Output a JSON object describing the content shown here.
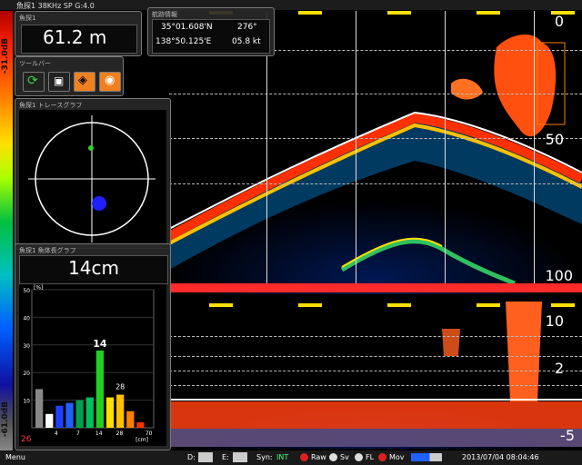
{
  "header": {
    "label": "魚探1 38KHz SP G:4.0"
  },
  "scale": {
    "top_label": "-31.0dB",
    "bottom_label": "-61.0dB"
  },
  "depth_box": {
    "title": "魚探1",
    "value": "61.2 m"
  },
  "position_box": {
    "title": "航跡情報",
    "lat": "35°01.608'N",
    "heading": "276°",
    "lon": "138°50.125'E",
    "speed": "05.8 kt"
  },
  "toolbar": {
    "title": "ツールバー",
    "buttons": [
      "refresh-icon",
      "camera-icon",
      "fish-icon",
      "record-icon"
    ]
  },
  "trace_panel": {
    "title": "魚探1 トレースグラフ"
  },
  "hist_panel": {
    "title": "魚探1 魚体長グラフ",
    "size": "14cm",
    "peak_label": "14",
    "secondary_label": "28",
    "left_bottom": "26"
  },
  "upper_echo": {
    "depth_labels": [
      "0",
      "50",
      "100"
    ]
  },
  "lower_echo": {
    "depth_labels": [
      "10",
      "2",
      "-5"
    ]
  },
  "status": {
    "menu": "Menu",
    "d_label": "D:",
    "e_label": "E:",
    "syn_label": "Syn:",
    "syn_value": "INT",
    "raw": "Raw",
    "sv": "Sv",
    "fl": "FL",
    "mov": "Mov",
    "datetime": "2013/07/04  08:04:46"
  },
  "colors": {
    "accent_yellow": "#ffe000",
    "bar_red": "#ff2a2a",
    "raw_red": "#e02020"
  },
  "chart_data": {
    "type": "bar",
    "x_ticks": [
      "4",
      "7",
      "14",
      "28",
      "70"
    ],
    "x_unit": "[cm]",
    "y_unit": "[%]",
    "y_ticks": [
      "50",
      "40",
      "30",
      "20",
      "10"
    ],
    "ylim": [
      0,
      50
    ],
    "bars": [
      {
        "x": 0,
        "value": 14,
        "color": "#888888"
      },
      {
        "x": 1,
        "value": 5,
        "color": "#ffffff"
      },
      {
        "x": 2,
        "value": 8,
        "color": "#2040ff"
      },
      {
        "x": 3,
        "value": 9,
        "color": "#2060ff"
      },
      {
        "x": 4,
        "value": 10,
        "color": "#00a050"
      },
      {
        "x": 5,
        "value": 11,
        "color": "#00c060"
      },
      {
        "x": 6,
        "value": 28,
        "color": "#20d020"
      },
      {
        "x": 7,
        "value": 11,
        "color": "#ffe000"
      },
      {
        "x": 8,
        "value": 12,
        "color": "#ffc000"
      },
      {
        "x": 9,
        "value": 6,
        "color": "#ff8000"
      },
      {
        "x": 10,
        "value": 2,
        "color": "#ff3000"
      }
    ]
  }
}
